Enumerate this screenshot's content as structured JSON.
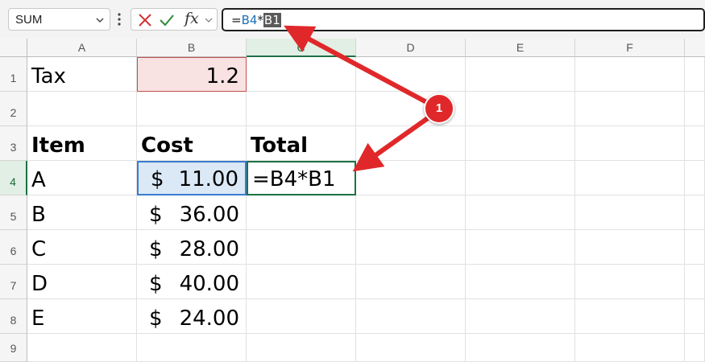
{
  "formula_bar": {
    "name_box": "SUM",
    "formula_tokens": [
      {
        "text": "=",
        "role": "eq"
      },
      {
        "text": "B4",
        "role": "ref1"
      },
      {
        "text": "*",
        "role": "op"
      },
      {
        "text": "B1",
        "role": "selected"
      }
    ],
    "fx_label": "fx"
  },
  "columns": [
    "A",
    "B",
    "C",
    "D",
    "E",
    "F"
  ],
  "rows": [
    "1",
    "2",
    "3",
    "4",
    "5",
    "6",
    "7",
    "8",
    "9"
  ],
  "cells": {
    "A1": "Tax",
    "B1": "1.2",
    "A3": "Item",
    "B3": "Cost",
    "C3": "Total",
    "A4": "A",
    "B4_currency": "$",
    "B4_value": "11.00",
    "C4": "=B4*B1",
    "A5": "B",
    "B5_currency": "$",
    "B5_value": "36.00",
    "A6": "C",
    "B6_currency": "$",
    "B6_value": "28.00",
    "A7": "D",
    "B7_currency": "$",
    "B7_value": "40.00",
    "A8": "E",
    "B8_currency": "$",
    "B8_value": "24.00"
  },
  "annotation": {
    "badge": "1"
  },
  "colors": {
    "accent_green": "#1e7145",
    "ref_blue": "#3a7ccf",
    "ref_red": "#c0504d",
    "arrow_red": "#e0282a"
  }
}
